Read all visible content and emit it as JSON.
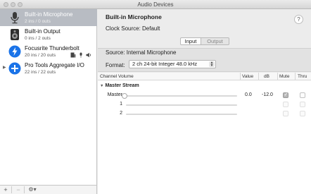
{
  "window": {
    "title": "Audio Devices"
  },
  "sidebar": {
    "devices": [
      {
        "name": "Built-in Microphone",
        "sub": "2 ins / 0 outs",
        "icon": "microphone-icon",
        "selected": true
      },
      {
        "name": "Built-in Output",
        "sub": "0 ins / 2 outs",
        "icon": "speaker-icon",
        "selected": false
      },
      {
        "name": "Focusrite Thunderbolt",
        "sub": "20 ins / 20 outs",
        "icon": "thunderbolt-icon",
        "selected": false
      },
      {
        "name": "Pro Tools Aggregate I/O",
        "sub": "22 ins / 22 outs",
        "icon": "aggregate-plus-icon",
        "selected": false
      }
    ],
    "footer": {
      "add": "+",
      "remove": "−",
      "gear": "⚙▾"
    }
  },
  "main": {
    "device_title": "Built-in Microphone",
    "clock_source": "Clock Source:  Default",
    "help": "?",
    "tabs": {
      "input": "Input",
      "output": "Output",
      "active": "input"
    },
    "source": "Source:  Internal Microphone",
    "format_label": "Format:",
    "format_value": "2 ch 24-bit Integer 48.0 kHz"
  },
  "table": {
    "columns": {
      "channel_volume": "Channel Volume",
      "value": "Value",
      "db": "dB",
      "mute": "Mute",
      "thru": "Thru"
    },
    "group": "Master Stream",
    "rows": [
      {
        "label": "Master",
        "value": "0.0",
        "db": "-12.0",
        "mute": true,
        "enabled": true
      },
      {
        "label": "1",
        "value": "",
        "db": "",
        "mute": false,
        "enabled": false
      },
      {
        "label": "2",
        "value": "",
        "db": "",
        "mute": false,
        "enabled": false
      }
    ]
  },
  "colors": {
    "selection": "#b8bcc3",
    "window_bg": "#ececec",
    "accent_thunderbolt": "#1a73e8"
  }
}
